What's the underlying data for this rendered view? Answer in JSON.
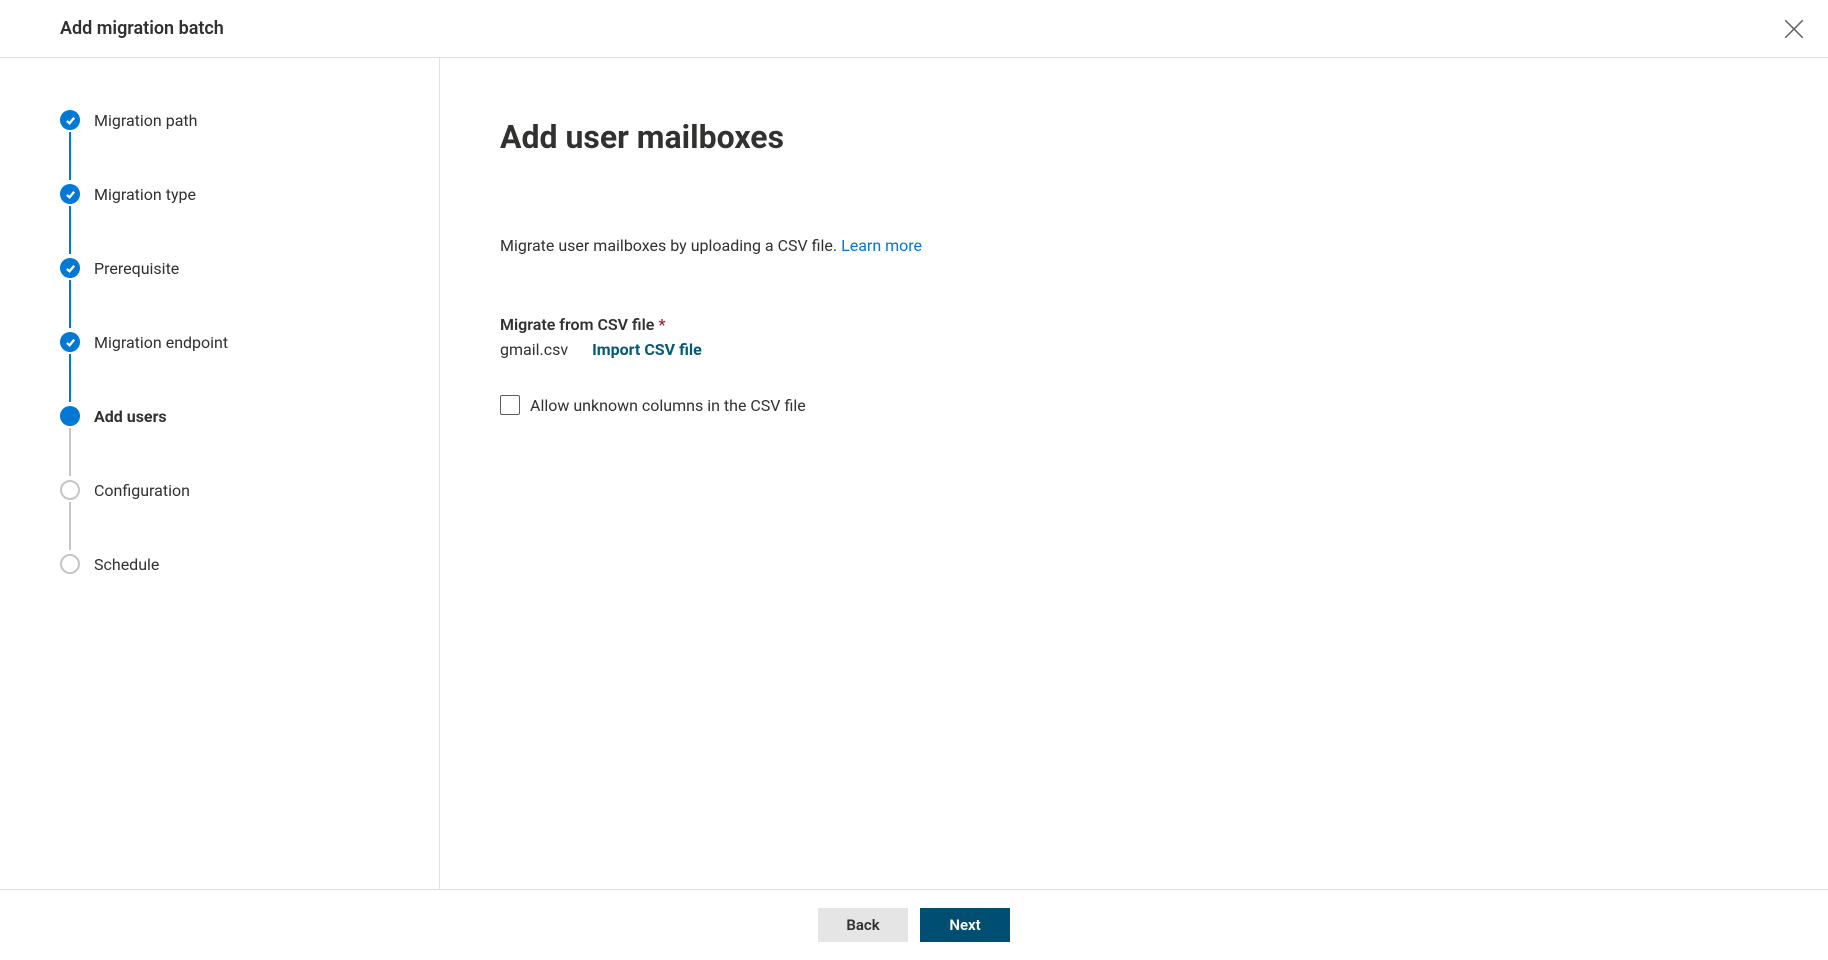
{
  "header": {
    "title": "Add migration batch"
  },
  "steps": [
    {
      "label": "Migration path",
      "state": "completed"
    },
    {
      "label": "Migration type",
      "state": "completed"
    },
    {
      "label": "Prerequisite",
      "state": "completed"
    },
    {
      "label": "Migration endpoint",
      "state": "completed"
    },
    {
      "label": "Add users",
      "state": "current"
    },
    {
      "label": "Configuration",
      "state": "upcoming"
    },
    {
      "label": "Schedule",
      "state": "upcoming"
    }
  ],
  "content": {
    "title": "Add user mailboxes",
    "description_text": "Migrate user mailboxes by uploading a CSV file. ",
    "learn_more": "Learn more",
    "csv_label": "Migrate from CSV file",
    "csv_required": "*",
    "csv_file_name": "gmail.csv",
    "import_action": "Import CSV file",
    "allow_unknown_label": "Allow unknown columns in the CSV file"
  },
  "footer": {
    "back": "Back",
    "next": "Next"
  }
}
